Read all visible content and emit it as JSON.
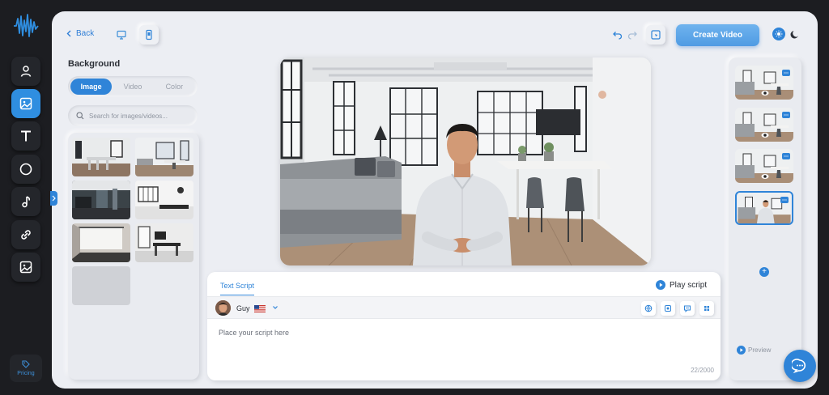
{
  "topbar": {
    "back_label": "Back",
    "create_label": "Create Video"
  },
  "background_panel": {
    "title": "Background",
    "tabs": [
      "Image",
      "Video",
      "Color"
    ],
    "active_tab": "Image",
    "search_placeholder": "Search for images/videos..."
  },
  "script": {
    "tab_label": "Text Script",
    "play_label": "Play script",
    "voice_name": "Guy",
    "placeholder": "Place your script here",
    "char_count": "22/2000"
  },
  "scenes": {
    "count": 4,
    "preview_label": "Preview"
  },
  "pricing_label": "Pricing",
  "colors": {
    "accent": "#2f84d8",
    "rail": "#1c1d21",
    "panel": "#eceef3"
  }
}
